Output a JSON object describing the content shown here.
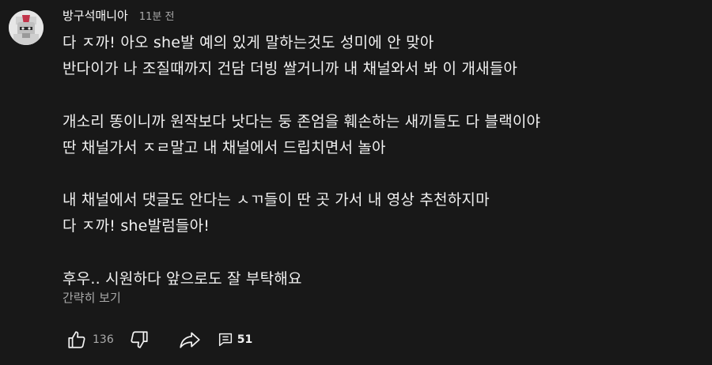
{
  "comment": {
    "author": "방구석매니아",
    "time": "11분 전",
    "lines": [
      "다 ㅈ까! 아오 she발 예의 있게 말하는것도 성미에 안 맞아",
      "반다이가 나 조질때까지 건담 더빙 쌀거니까 내 채널와서 봐 이 개새들아",
      "",
      "개소리 똥이니까 원작보다 낫다는 둥 존엄을 훼손하는 새끼들도 다 블랙이야",
      "딴 채널가서 ㅈㄹ말고 내 채널에서 드립치면서 놀아",
      "",
      "내 채널에서 댓글도 안다는 ㅅㄲ들이 딴 곳 가서 내 영상 추천하지마",
      "다 ㅈ까! she발럼들아!",
      "",
      "후우.. 시원하다 앞으로도 잘 부탁해요"
    ],
    "collapse_label": "간략히 보기",
    "like_count": "136",
    "reply_count": "51"
  },
  "icons": {
    "like": "thumbs-up-icon",
    "dislike": "thumbs-down-icon",
    "share": "share-icon",
    "replies": "comment-icon"
  },
  "colors": {
    "background": "#181818",
    "text": "#f1f1f1",
    "secondary": "#aaaaaa"
  }
}
